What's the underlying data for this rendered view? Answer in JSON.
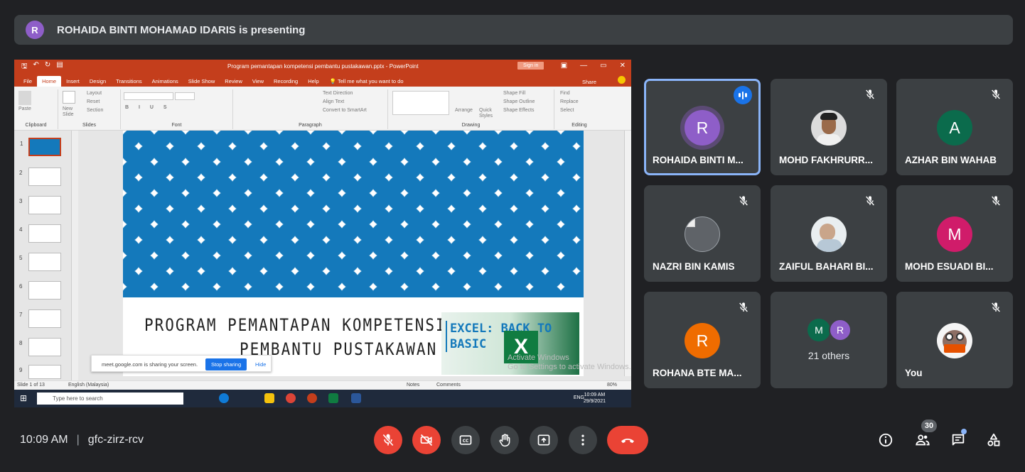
{
  "banner": {
    "avatar_letter": "R",
    "text": "ROHAIDA BINTI MOHAMAD IDARIS is presenting"
  },
  "ppt": {
    "window_title": "Program pemantapan kompetensi pembantu pustakawan.pptx - PowerPoint",
    "sign_in": "Sign in",
    "tabs": [
      "File",
      "Home",
      "Insert",
      "Design",
      "Transitions",
      "Animations",
      "Slide Show",
      "Review",
      "View",
      "Recording",
      "Help"
    ],
    "tell_me": "Tell me what you want to do",
    "share": "Share",
    "groups": {
      "clipboard": "Clipboard",
      "slides": "Slides",
      "font": "Font",
      "paragraph": "Paragraph",
      "drawing": "Drawing",
      "editing": "Editing"
    },
    "ribbon_items": {
      "paste": "Paste",
      "new_slide": "New Slide",
      "layout": "Layout",
      "reset": "Reset",
      "section": "Section",
      "text_direction": "Text Direction",
      "align_text": "Align Text",
      "convert_smartart": "Convert to SmartArt",
      "arrange": "Arrange",
      "quick_styles": "Quick Styles",
      "shape_fill": "Shape Fill",
      "shape_outline": "Shape Outline",
      "shape_effects": "Shape Effects",
      "find": "Find",
      "replace": "Replace",
      "select": "Select"
    },
    "thumb_numbers": [
      "1",
      "2",
      "3",
      "4",
      "5",
      "6",
      "7",
      "8",
      "9"
    ],
    "slide": {
      "title_line1": "PROGRAM PEMANTAPAN KOMPETENSI",
      "title_line2": "PEMBANTU PUSTAKAWAN",
      "excel_line1": "EXCEL: BACK TO",
      "excel_line2": "BASIC",
      "excel_logo": "X"
    },
    "activate_line1": "Activate Windows",
    "activate_line2": "Go to Settings to activate Windows.",
    "status": {
      "slide_of": "Slide 1 of 13",
      "language": "English (Malaysia)",
      "notes": "Notes",
      "comments": "Comments",
      "zoom": "80%"
    },
    "sharebar": {
      "message": "meet.google.com is sharing your screen.",
      "stop": "Stop sharing",
      "hide": "Hide"
    },
    "taskbar": {
      "search": "Type here to search",
      "lang": "ENG",
      "time": "10:09 AM",
      "date": "29/9/2021"
    }
  },
  "participants": [
    {
      "name": "ROHAIDA BINTI M...",
      "letter": "R",
      "color": "#8e5ec8",
      "speaking": true
    },
    {
      "name": "MOHD FAKHRURR...",
      "letter": "",
      "color": "#d9d9d9",
      "photo": true
    },
    {
      "name": "AZHAR BIN WAHAB",
      "letter": "A",
      "color": "#0b6b4c"
    },
    {
      "name": "NAZRI BIN KAMIS",
      "letter": "",
      "color": "#5f6368",
      "broken": true
    },
    {
      "name": "ZAIFUL BAHARI BI...",
      "letter": "",
      "color": "#cfd8dc",
      "photo": true
    },
    {
      "name": "MOHD ESUADI BI...",
      "letter": "M",
      "color": "#d01c6a"
    },
    {
      "name": "ROHANA BTE MA...",
      "letter": "R",
      "color": "#ef6c00"
    },
    {
      "name": "21 others",
      "letters": [
        "M",
        "R"
      ],
      "colors": [
        "#0b6b4c",
        "#8e5ec8"
      ]
    },
    {
      "name": "You",
      "letter": "",
      "color": "#f2f2f2",
      "photo": true
    }
  ],
  "bottom": {
    "time": "10:09 AM",
    "meeting_code": "gfc-zirz-rcv",
    "participant_count": "30"
  },
  "colors": {
    "background": "#202124",
    "tile": "#3c4043",
    "accent": "#8ab4f8",
    "danger": "#ea4335",
    "ppt_brand": "#c43e1c"
  }
}
